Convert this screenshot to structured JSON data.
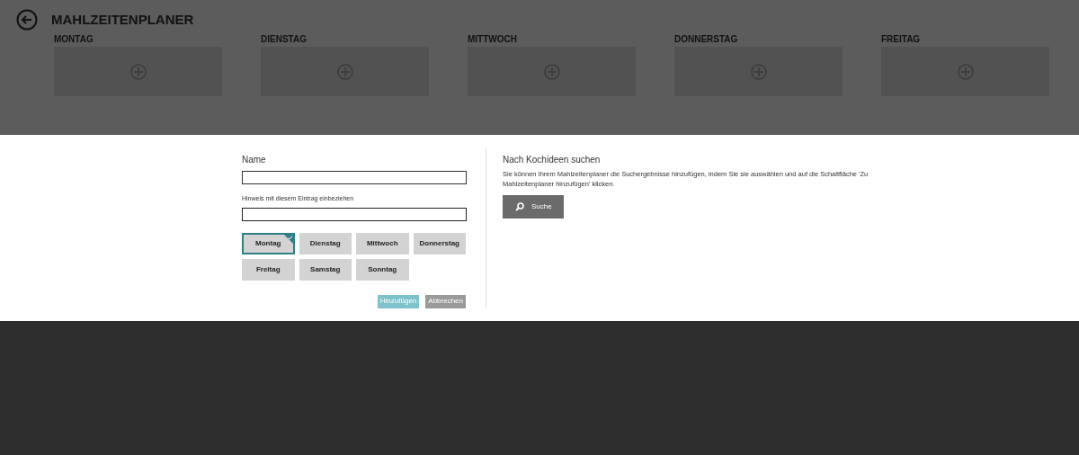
{
  "header": {
    "title": "MAHLZEITENPLANER"
  },
  "days": [
    {
      "label": "MONTAG"
    },
    {
      "label": "DIENSTAG"
    },
    {
      "label": "MITTWOCH"
    },
    {
      "label": "DONNERSTAG"
    },
    {
      "label": "FREITAG"
    }
  ],
  "dialog": {
    "name_label": "Name",
    "hint_label": "Hinweis mit diesem Eintrag einbeziehen",
    "day_buttons": [
      {
        "label": "Montag",
        "selected": true
      },
      {
        "label": "Dienstag",
        "selected": false
      },
      {
        "label": "Mittwoch",
        "selected": false
      },
      {
        "label": "Donnerstag",
        "selected": false
      },
      {
        "label": "Freitag",
        "selected": false
      },
      {
        "label": "Samstag",
        "selected": false
      },
      {
        "label": "Sonntag",
        "selected": false
      }
    ],
    "add_button": "Hinzufügen",
    "cancel_button": "Abbrechen",
    "search_title": "Nach Kochideen suchen",
    "search_text": "Sie können Ihrem Mahlzeitenplaner die Suchergebnisse hinzufügen, indem Sie sie auswählen und auf die Schaltfläche 'Zu Mahlzeitenplaner hinzufügen' klicken.",
    "search_button": "Suche"
  }
}
